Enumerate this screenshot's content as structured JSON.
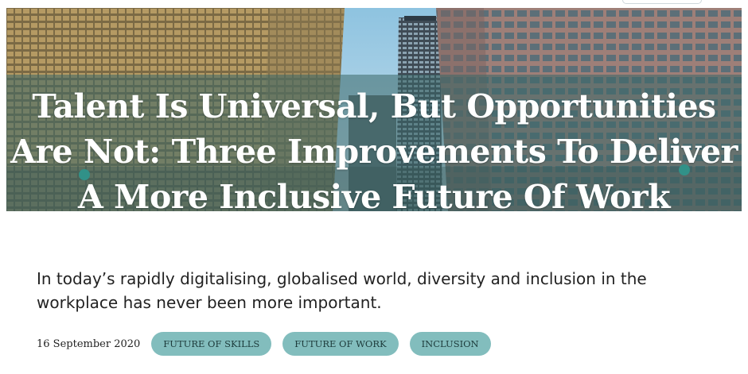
{
  "article": {
    "title": "Talent Is Universal, But Opportunities Are Not: Three Improvements To Deliver A More Inclusive Future Of Work",
    "intro": "In today’s rapidly digitalising, globalised world, diversity and inclusion in the workplace has never been more important.",
    "date": "16 September 2020",
    "tags": [
      "FUTURE OF SKILLS",
      "FUTURE OF WORK",
      "INCLUSION"
    ]
  },
  "colors": {
    "tag_bg": "#82bdbd",
    "band": "#3a6868",
    "text": "#222222"
  }
}
